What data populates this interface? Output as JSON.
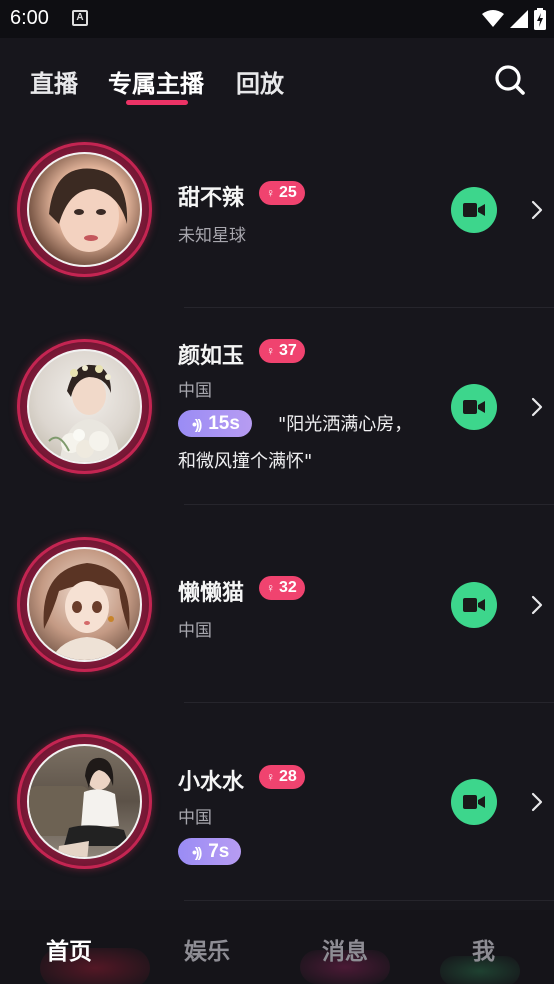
{
  "status_bar": {
    "time": "6:00",
    "notification_icon": "A"
  },
  "top_tabs": [
    {
      "label": "直播",
      "active": false
    },
    {
      "label": "专属主播",
      "active": true
    },
    {
      "label": "回放",
      "active": false
    }
  ],
  "search": {
    "icon": "search-icon"
  },
  "anchors": [
    {
      "name": "甜不辣",
      "age": "25",
      "gender_symbol": "♀",
      "location": "未知星球",
      "voice": null,
      "quote": null
    },
    {
      "name": "颜如玉",
      "age": "37",
      "gender_symbol": "♀",
      "location": "中国",
      "voice": "15s",
      "quote": "\"阳光洒满心房，和微风撞个满怀\""
    },
    {
      "name": "懒懒猫",
      "age": "32",
      "gender_symbol": "♀",
      "location": "中国",
      "voice": null,
      "quote": null
    },
    {
      "name": "小水水",
      "age": "28",
      "gender_symbol": "♀",
      "location": "中国",
      "voice": "7s",
      "quote": null
    }
  ],
  "bottom_nav": [
    {
      "label": "首页",
      "active": true
    },
    {
      "label": "娱乐",
      "active": false
    },
    {
      "label": "消息",
      "active": false
    },
    {
      "label": "我",
      "active": false
    }
  ],
  "colors": {
    "accent": "#ec3366",
    "badge": "#f0436f",
    "call": "#3dd68c",
    "voice_gradient_start": "#9a8cf5"
  }
}
